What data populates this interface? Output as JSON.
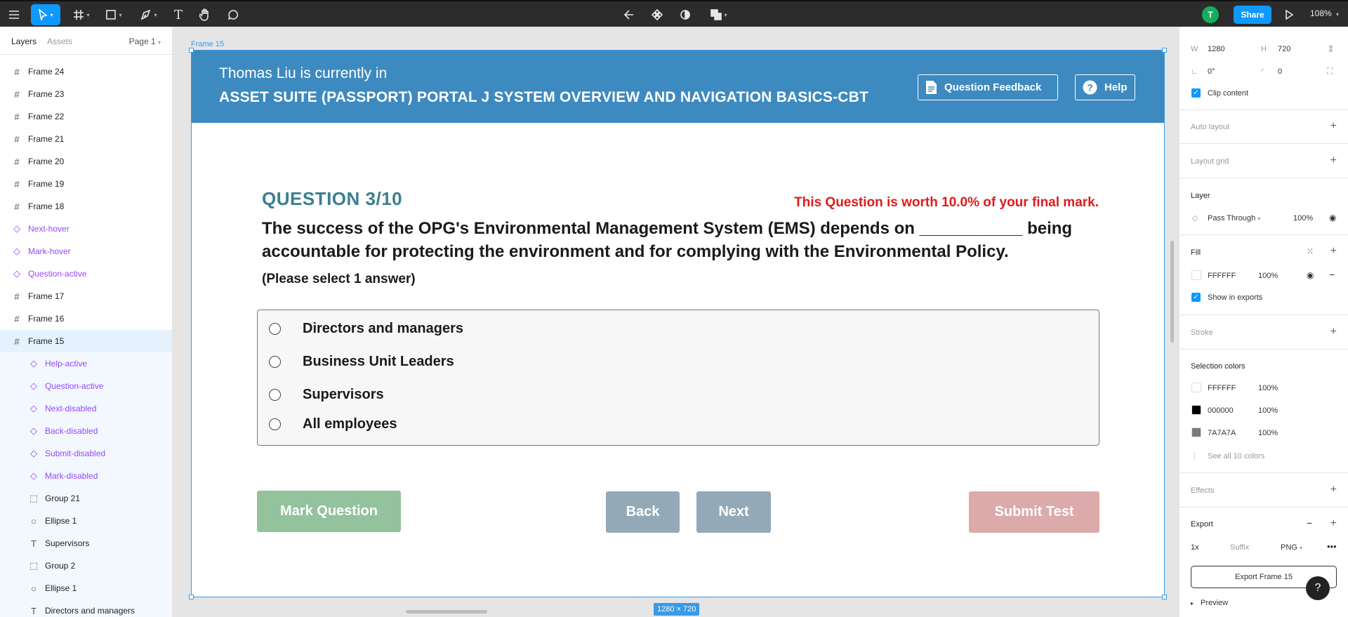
{
  "toolbar": {
    "avatar_initial": "T",
    "share_label": "Share",
    "zoom": "108%"
  },
  "left_panel": {
    "tab_layers": "Layers",
    "tab_assets": "Assets",
    "page": "Page 1",
    "layers": [
      {
        "label": "Frame 24",
        "type": "frame"
      },
      {
        "label": "Frame 23",
        "type": "frame"
      },
      {
        "label": "Frame 22",
        "type": "frame"
      },
      {
        "label": "Frame 21",
        "type": "frame"
      },
      {
        "label": "Frame 20",
        "type": "frame"
      },
      {
        "label": "Frame 19",
        "type": "frame"
      },
      {
        "label": "Frame 18",
        "type": "frame"
      },
      {
        "label": "Next-hover",
        "type": "component"
      },
      {
        "label": "Mark-hover",
        "type": "component"
      },
      {
        "label": "Question-active",
        "type": "component"
      },
      {
        "label": "Frame 17",
        "type": "frame"
      },
      {
        "label": "Frame 16",
        "type": "frame"
      },
      {
        "label": "Frame 15",
        "type": "frame-selected"
      },
      {
        "label": "Help-active",
        "type": "component-child"
      },
      {
        "label": "Question-active",
        "type": "component-child"
      },
      {
        "label": "Next-disabled",
        "type": "component-child"
      },
      {
        "label": "Back-disabled",
        "type": "component-child"
      },
      {
        "label": "Submit-disabled",
        "type": "component-child"
      },
      {
        "label": "Mark-disabled",
        "type": "component-child"
      },
      {
        "label": "Group 21",
        "type": "group-child"
      },
      {
        "label": "Ellipse 1",
        "type": "ellipse-child"
      },
      {
        "label": "Supervisors",
        "type": "text-child"
      },
      {
        "label": "Group 2",
        "type": "group-child"
      },
      {
        "label": "Ellipse 1",
        "type": "ellipse-child"
      },
      {
        "label": "Directors and managers",
        "type": "text-child"
      }
    ]
  },
  "canvas": {
    "frame_label": "Frame 15",
    "size_badge": "1280 × 720"
  },
  "frame": {
    "user_name": "Thomas Liu",
    "user_suffix": " is currently in",
    "course_title": "ASSET SUITE (PASSPORT) PORTAL J SYSTEM OVERVIEW AND NAVIGATION BASICS-CBT",
    "feedback_label": "Question Feedback",
    "help_label": "Help",
    "question_number": "QUESTION 3/10",
    "question_worth": "This Question is worth 10.0% of your final mark.",
    "question_text": "The success of the OPG's Environmental Management System (EMS) depends on ___________ being accountable for protecting the environment and for complying with the Environmental Policy.",
    "instruction": "(Please select 1 answer)",
    "answers": [
      "Directors and managers",
      "Business Unit Leaders",
      "Supervisors",
      "All employees"
    ],
    "mark_label": "Mark Question",
    "back_label": "Back",
    "next_label": "Next",
    "submit_label": "Submit Test"
  },
  "right_panel": {
    "w_label": "W",
    "w_value": "1280",
    "h_label": "H",
    "h_value": "720",
    "rotation": "0°",
    "radius": "0",
    "clip_content": "Clip content",
    "auto_layout": "Auto layout",
    "layout_grid": "Layout grid",
    "layer_title": "Layer",
    "blend_mode": "Pass Through",
    "layer_opacity": "100%",
    "fill_title": "Fill",
    "fill_hex": "FFFFFF",
    "fill_opacity": "100%",
    "show_in_exports": "Show in exports",
    "stroke_title": "Stroke",
    "selection_colors_title": "Selection colors",
    "selection_colors": [
      {
        "hex": "FFFFFF",
        "opacity": "100%",
        "color": "#ffffff"
      },
      {
        "hex": "000000",
        "opacity": "100%",
        "color": "#000000"
      },
      {
        "hex": "7A7A7A",
        "opacity": "100%",
        "color": "#7a7a7a"
      }
    ],
    "see_all_colors": "See all 10 colors",
    "effects_title": "Effects",
    "export_title": "Export",
    "export_scale": "1x",
    "export_suffix_placeholder": "Suffix",
    "export_format": "PNG",
    "export_button": "Export Frame 15",
    "preview": "Preview"
  },
  "colors": {
    "accent": "#0d99ff",
    "header_blue": "#3d8ac0",
    "question_teal": "#3b7f91",
    "worth_red": "#e11a1a"
  }
}
